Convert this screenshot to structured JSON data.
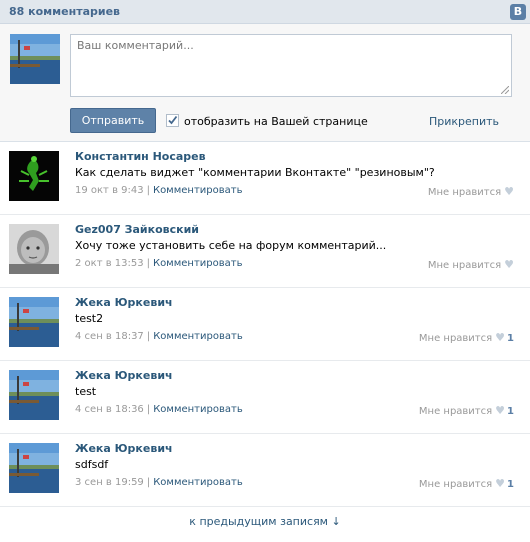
{
  "header": {
    "count_label": "88 комментариев",
    "vk_badge": "В"
  },
  "compose": {
    "placeholder": "Ваш комментарий...",
    "send_label": "Отправить",
    "checkbox_label": "отобразить на Вашей странице",
    "checkbox_checked": true,
    "attach_label": "Прикрепить"
  },
  "comments": [
    {
      "author": "Константин Носарев",
      "text": "Как сделать виджет \"комментарии Вконтакте\" \"резиновым\"?",
      "date": "19 окт в 9:43",
      "reply_label": "Комментировать",
      "like_label": "Мне нравится",
      "likes": "",
      "avatar_icon": "scorpion-avatar"
    },
    {
      "author": "Gez007 Зайковский",
      "text": "Хочу тоже установить себе на форум комментарий...",
      "date": "2 окт в 13:53",
      "reply_label": "Комментировать",
      "like_label": "Мне нравится",
      "likes": "",
      "avatar_icon": "baby-photo-avatar"
    },
    {
      "author": "Жека Юркевич",
      "text": "test2",
      "date": "4 сен в 18:37",
      "reply_label": "Комментировать",
      "like_label": "Мне нравится",
      "likes": "1",
      "avatar_icon": "lake-photo-avatar"
    },
    {
      "author": "Жека Юркевич",
      "text": "test",
      "date": "4 сен в 18:36",
      "reply_label": "Комментировать",
      "like_label": "Мне нравится",
      "likes": "1",
      "avatar_icon": "lake-photo-avatar"
    },
    {
      "author": "Жека Юркевич",
      "text": "sdfsdf",
      "date": "3 сен в 19:59",
      "reply_label": "Комментировать",
      "like_label": "Мне нравится",
      "likes": "1",
      "avatar_icon": "lake-photo-avatar"
    }
  ],
  "more_label": "к предыдущим записям ↓",
  "colors": {
    "link": "#2b587a",
    "header_bg": "#e1e7ed",
    "button": "#5e82a8"
  }
}
